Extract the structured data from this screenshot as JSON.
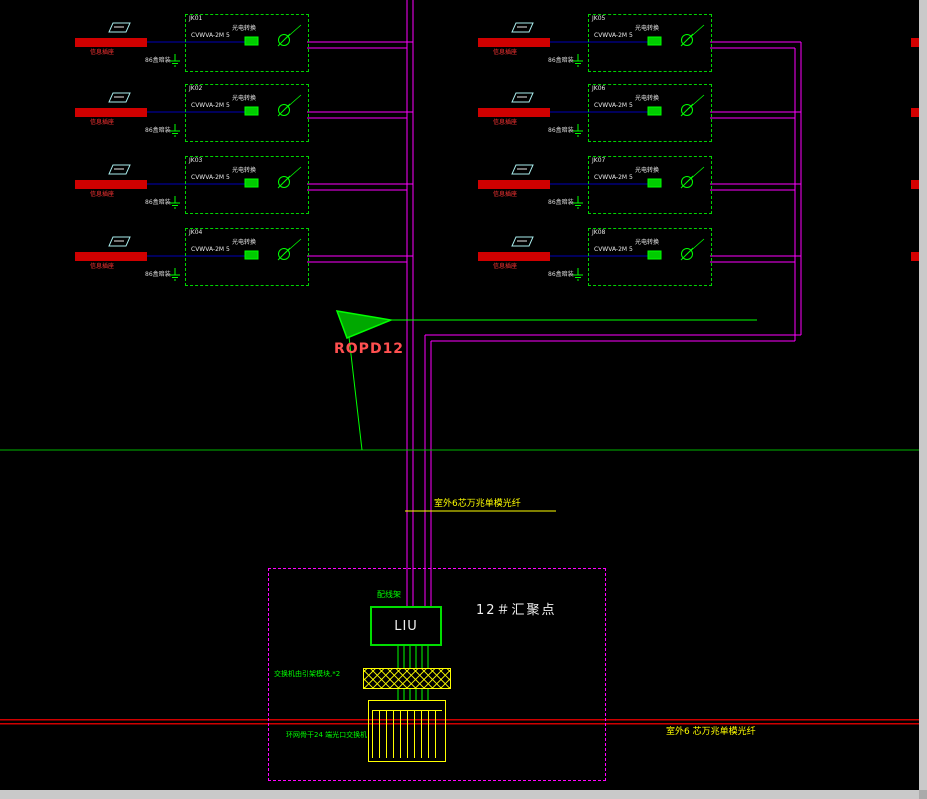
{
  "colors": {
    "background": "#000000",
    "wire_magenta": "#ff00ff",
    "wire_green": "#00ff00",
    "wire_red": "#d00000",
    "wire_navy": "#0000b8",
    "annotation_yellow": "#ffff00",
    "text_white": "#f0f0f0",
    "label_red": "#ff5050"
  },
  "labels": {
    "ropd": "ROPD12",
    "fiber_top": "室外6芯万兆单模光纤",
    "fiber_bottom": "室外6 芯万兆单模光纤",
    "patch_panel": "配线架",
    "liu": "LIU",
    "aggregation_point": "12＃汇聚点",
    "switch_module": "交换机由引架模块,*2",
    "ring_switch": "环网骨干24 端光口交换机"
  },
  "block_labels": {
    "cable": "CVWVA-2M 5",
    "module": "光电转换",
    "outlet": "信息插座",
    "mount": "86盒暗装"
  },
  "blocks": [
    {
      "id": "JK01"
    },
    {
      "id": "JK02"
    },
    {
      "id": "JK03"
    },
    {
      "id": "JK04"
    },
    {
      "id": "JK05"
    },
    {
      "id": "JK06"
    },
    {
      "id": "JK07"
    },
    {
      "id": "JK08"
    }
  ]
}
